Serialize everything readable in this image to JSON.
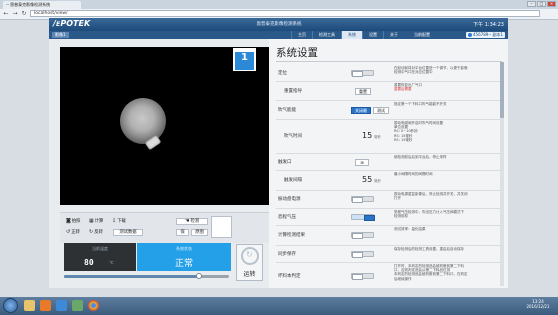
{
  "browser": {
    "tab_title": "-- 恩普泰克影像检测系统",
    "url": "localhost/view/",
    "back_icon": "back-arrow-icon",
    "forward_icon": "forward-arrow-icon",
    "refresh_icon": "refresh-icon"
  },
  "app": {
    "logo": "/ᴇPOTEK",
    "title": "恩普泰克影像检测系统",
    "clock": "下午 1:34:23",
    "camera_tab": "影像1",
    "menu": [
      "主页",
      "检测工具",
      "系统",
      "设置",
      "关于"
    ],
    "active_menu": 2,
    "mode": "当前配置",
    "user": "456789-- 副本1"
  },
  "camera": {
    "channel_number": "1"
  },
  "controls": {
    "row1": [
      {
        "icon": "camera-icon",
        "label": "拍照"
      },
      {
        "icon": "calculator-icon",
        "label": "计算"
      },
      {
        "icon": "download-icon",
        "label": "下载"
      }
    ],
    "row1_right": {
      "icon": "hand-icon",
      "label": "检测"
    },
    "row2": [
      {
        "icon": "rotate-left-icon",
        "label": "正转"
      },
      {
        "icon": "rotate-right-icon",
        "label": "反转"
      },
      {
        "icon": "",
        "label": "测试数据"
      }
    ],
    "row2_right": [
      {
        "label": "保"
      },
      {
        "label": "原图"
      }
    ],
    "temperature_label": "当前温度",
    "temperature_value": "80",
    "temperature_unit": "℃",
    "status_label": "系统状态",
    "status_value": "正常",
    "slider_level": 0.82,
    "run_label": "运转"
  },
  "settings": {
    "title": "系统设置",
    "items": [
      {
        "label": "定位",
        "control": "toggle",
        "on": false,
        "desc": [
          "在起动前将对平台位置进一个调节，以便于影像",
          "检测中气口在对应位置中"
        ]
      },
      {
        "label": "重置指导",
        "control": "button",
        "button": "重置",
        "desc": [
          "重置恢复出厂气口",
          "重置后需要"
        ],
        "desc_red_line": 1
      },
      {
        "label": "吹气能能",
        "control": "button_pair",
        "buttons": [
          "关闭最",
          "测试"
        ],
        "desc": [
          "指定第一个下料口吹气能能不开关"
        ]
      },
      {
        "label": "吹气时间",
        "control": "number",
        "value": "15",
        "unit": "毫秒",
        "desc": [
          "振动电磁阀开启时吹气时间设置",
          "单位设置",
          "RS: 0~10秒钟",
          "RS: 15毫秒",
          "RS: 15毫秒"
        ]
      },
      {
        "label": "触发口",
        "control": "stepper",
        "symbol": "⊞",
        "desc": [
          "使检测前后后到平台后，停止采样"
        ]
      },
      {
        "label": "触发间隔",
        "control": "number",
        "value": "55",
        "unit": "毫秒",
        "desc": [
          "最小间隔时间的间隔时间"
        ]
      },
      {
        "label": "振动盘电源",
        "control": "toggle",
        "on": false,
        "desc": [
          "振动电源重复影像后，停止检测并开关，并关闭",
          "打开"
        ]
      },
      {
        "label": "恐程气压",
        "control": "toggle",
        "on": true,
        "desc": [
          "恐程气压检测中，吹出压力计入气压阀模式下",
          "检测前前"
        ]
      },
      {
        "label": "计算检测结果",
        "control": "toggle",
        "on": false,
        "desc": [
          "测试效率：量化结果"
        ]
      },
      {
        "label": "同步保存",
        "control": "toggle",
        "on": false,
        "desc": [
          "保存检测后的检测工具设置，重启后自动保存"
        ]
      },
      {
        "label": "坏料本判定",
        "control": "toggle",
        "on": false,
        "desc": [
          "打开时，本判定的检测品会被判断到第二下料",
          "口，否则判定品会从第二下料品位排",
          "本判定的检测品会被判断到第二下料口，在判定",
          "后继续操作"
        ]
      }
    ]
  },
  "taskbar": {
    "start_icon": "windows-start-icon",
    "icons": [
      "folder-icon",
      "media-player-icon",
      "explorer-icon",
      "app-icon",
      "chrome-icon"
    ],
    "time": "13:24",
    "date": "2016/12/21"
  }
}
